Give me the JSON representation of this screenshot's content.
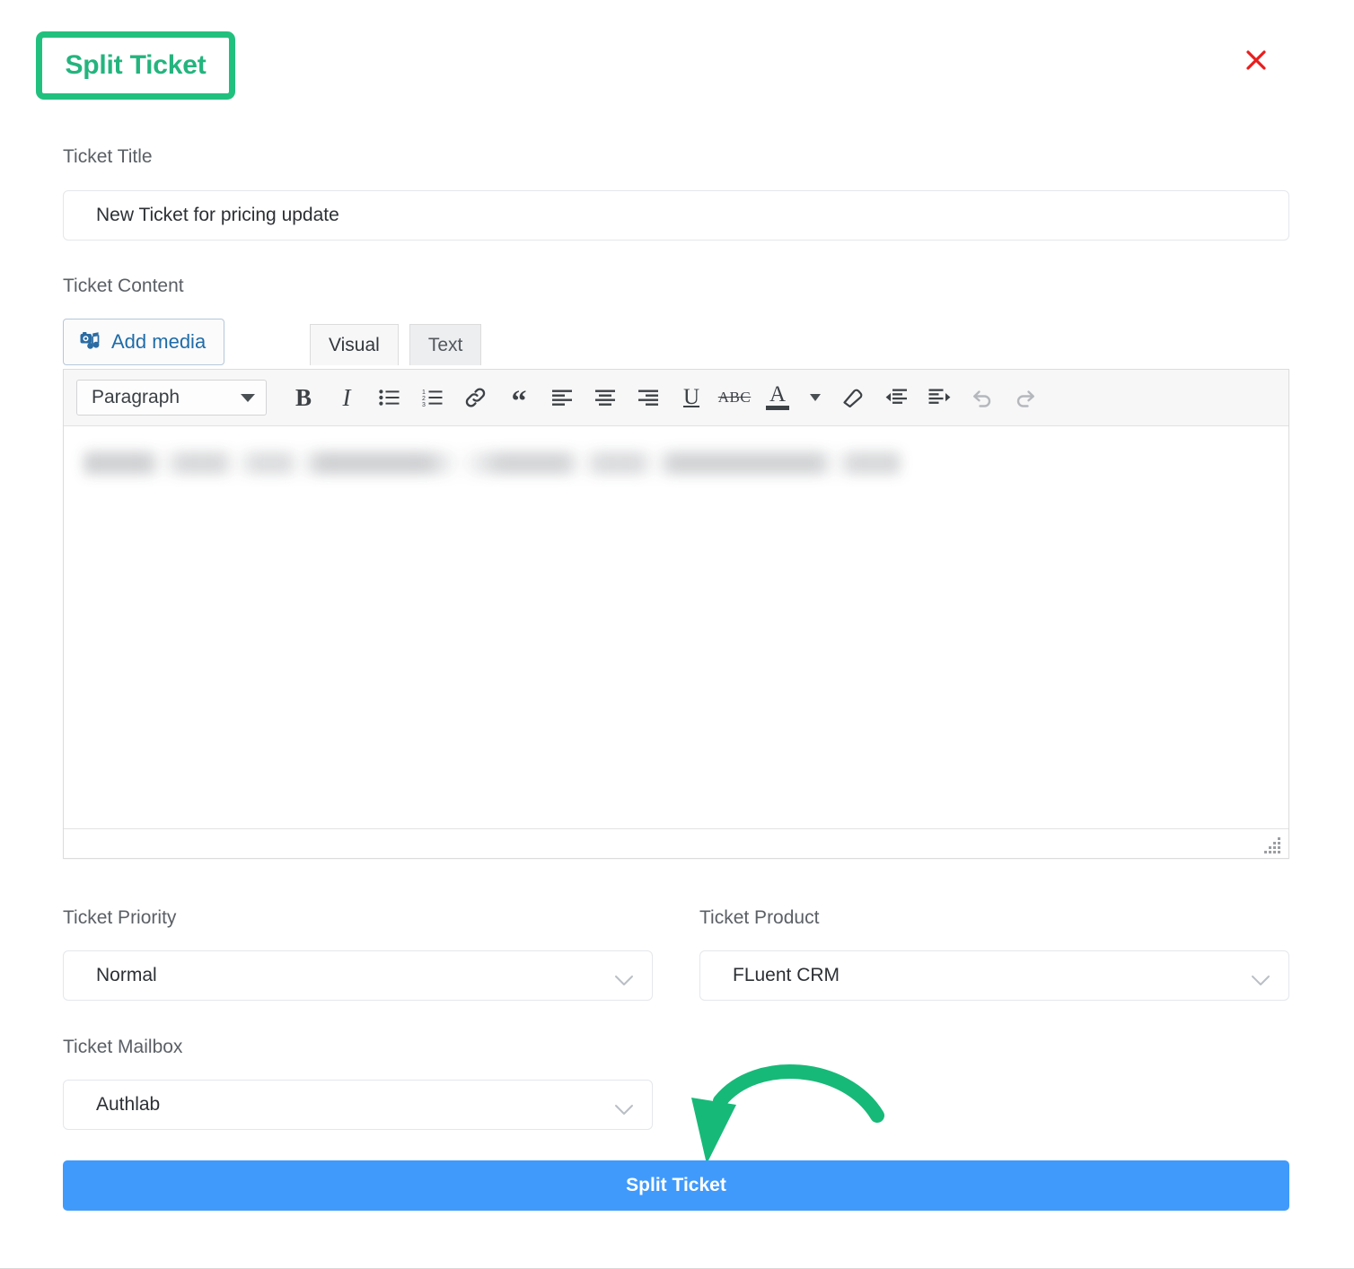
{
  "modal": {
    "title": "Split Ticket",
    "close_icon": "close-icon"
  },
  "fields": {
    "ticket_title": {
      "label": "Ticket Title",
      "value": "New Ticket for pricing update",
      "placeholder": "Ticket Title"
    },
    "ticket_content": {
      "label": "Ticket Content",
      "body_text": ""
    },
    "ticket_priority": {
      "label": "Ticket Priority",
      "value": "Normal"
    },
    "ticket_product": {
      "label": "Ticket Product",
      "value": "FLuent CRM"
    },
    "ticket_mailbox": {
      "label": "Ticket Mailbox",
      "value": "Authlab"
    }
  },
  "editor": {
    "add_media_label": "Add media",
    "add_media_icon": "media-icon",
    "tabs": [
      {
        "label": "Visual",
        "active": true
      },
      {
        "label": "Text",
        "active": false
      }
    ],
    "format_select": {
      "value": "Paragraph",
      "caret_icon": "caret-down-icon"
    },
    "toolbar_buttons": [
      {
        "name": "bold-icon",
        "label": "B"
      },
      {
        "name": "italic-icon",
        "label": "I"
      },
      {
        "name": "bullet-list-icon",
        "label": ""
      },
      {
        "name": "numbered-list-icon",
        "label": ""
      },
      {
        "name": "link-icon",
        "label": ""
      },
      {
        "name": "blockquote-icon",
        "label": ""
      },
      {
        "name": "align-left-icon",
        "label": ""
      },
      {
        "name": "align-center-icon",
        "label": ""
      },
      {
        "name": "align-right-icon",
        "label": ""
      },
      {
        "name": "underline-icon",
        "label": "U"
      },
      {
        "name": "strikethrough-icon",
        "label": "ABC"
      },
      {
        "name": "text-color-icon",
        "label": "A"
      },
      {
        "name": "text-color-caret-icon",
        "label": ""
      },
      {
        "name": "clear-formatting-icon",
        "label": ""
      },
      {
        "name": "outdent-icon",
        "label": ""
      },
      {
        "name": "indent-icon",
        "label": ""
      },
      {
        "name": "undo-icon",
        "label": ""
      },
      {
        "name": "redo-icon",
        "label": ""
      }
    ],
    "resize_handle": "resize-grip-icon"
  },
  "submit": {
    "label": "Split Ticket"
  },
  "colors": {
    "accent_green": "#22c07e",
    "title_green": "#24b47e",
    "primary_blue": "#409afc",
    "close_red": "#e81e1e",
    "label_gray": "#5b6066",
    "link_blue": "#1f6ca8"
  }
}
